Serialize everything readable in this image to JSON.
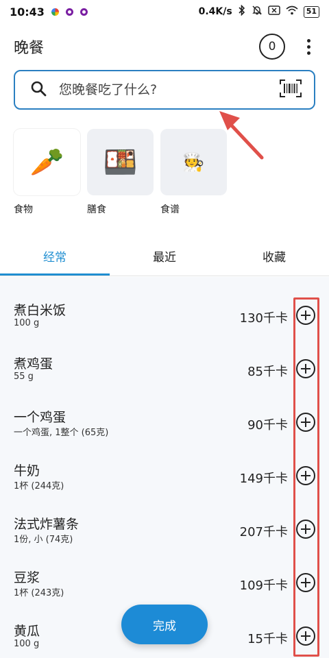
{
  "status_bar": {
    "time": "10:43",
    "network_speed": "0.4K/s",
    "battery": "51",
    "dot_colors": [
      "#3d3dc7",
      "#7a1fa2",
      "#7a1fa2"
    ]
  },
  "header": {
    "title": "晚餐",
    "count": "0",
    "more_icon": "more-vertical-icon"
  },
  "search": {
    "placeholder": "您晚餐吃了什么?",
    "search_icon": "search-icon",
    "scan_icon": "barcode-scan-icon"
  },
  "categories": [
    {
      "label": "食物",
      "emoji": "🥕",
      "icon": "carrot-icon"
    },
    {
      "label": "膳食",
      "emoji": "🍱",
      "icon": "bento-box-icon"
    },
    {
      "label": "食谱",
      "emoji": "🧑‍🍳",
      "icon": "cook-icon"
    }
  ],
  "tabs": [
    {
      "label": "经常",
      "active": true
    },
    {
      "label": "最近",
      "active": false
    },
    {
      "label": "收藏",
      "active": false
    }
  ],
  "foods": [
    {
      "name": "煮白米饭",
      "portion": "100 g",
      "calories": "130千卡"
    },
    {
      "name": "煮鸡蛋",
      "portion": "55 g",
      "calories": "85千卡"
    },
    {
      "name": "一个鸡蛋",
      "portion": "一个鸡蛋, 1整个 (65克)",
      "calories": "90千卡"
    },
    {
      "name": "牛奶",
      "portion": "1杯 (244克)",
      "calories": "149千卡"
    },
    {
      "name": "法式炸薯条",
      "portion": "1份, 小 (74克)",
      "calories": "207千卡"
    },
    {
      "name": "豆浆",
      "portion": "1杯 (243克)",
      "calories": "109千卡"
    },
    {
      "name": "黄瓜",
      "portion": "100 g",
      "calories": "15千卡"
    }
  ],
  "done_button": "完成",
  "colors": {
    "accent": "#1f8ed1",
    "search_border": "#2a7fc1",
    "annotation_red": "#e0504a"
  }
}
